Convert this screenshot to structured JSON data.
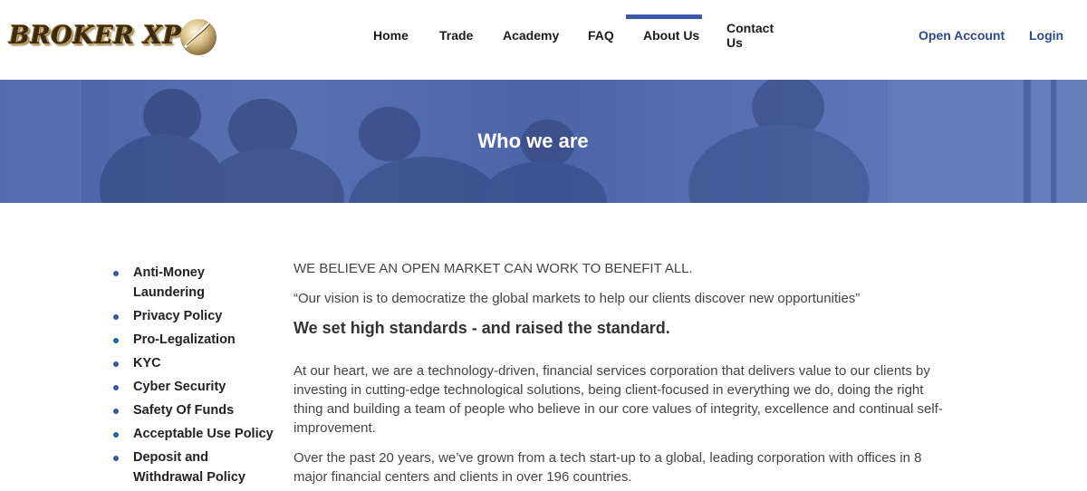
{
  "logo": {
    "text": "BROKER XP"
  },
  "nav": {
    "items": [
      {
        "label": "Home"
      },
      {
        "label": "Trade"
      },
      {
        "label": "Academy"
      },
      {
        "label": "FAQ"
      },
      {
        "label": "About Us",
        "active": true
      },
      {
        "label": "Contact Us"
      }
    ],
    "open_account": "Open Account",
    "login": "Login"
  },
  "banner": {
    "title": "Who we are"
  },
  "sidebar": {
    "items": [
      {
        "label": "Anti-Money Laundering"
      },
      {
        "label": "Privacy Policy"
      },
      {
        "label": "Pro-Legalization"
      },
      {
        "label": "KYC"
      },
      {
        "label": "Cyber Security"
      },
      {
        "label": "Safety Of Funds"
      },
      {
        "label": "Acceptable Use Policy"
      },
      {
        "label": "Deposit and Withdrawal Policy"
      }
    ]
  },
  "content": {
    "intro": "WE BELIEVE AN OPEN MARKET CAN WORK TO BENEFIT ALL.",
    "quote": "“Our vision is to democratize the global markets to help our clients discover new opportunities”",
    "heading": "We set high standards - and raised the standard.",
    "para1": "At our heart, we are a technology-driven, financial services corporation that delivers value to our clients by investing in cutting-edge technological solutions, being client-focused in everything we do, doing the right thing and building a team of people who believe in our core values of integrity, excellence and continual self-improvement.",
    "para2": "Over the past 20 years, we’ve grown from a tech start-up to a global, leading corporation with offices in 8 major financial centers and clients in over 196 countries."
  },
  "colors": {
    "accent": "#3b57a8",
    "link": "#2d4a8c",
    "banner": "#4d64a8"
  }
}
